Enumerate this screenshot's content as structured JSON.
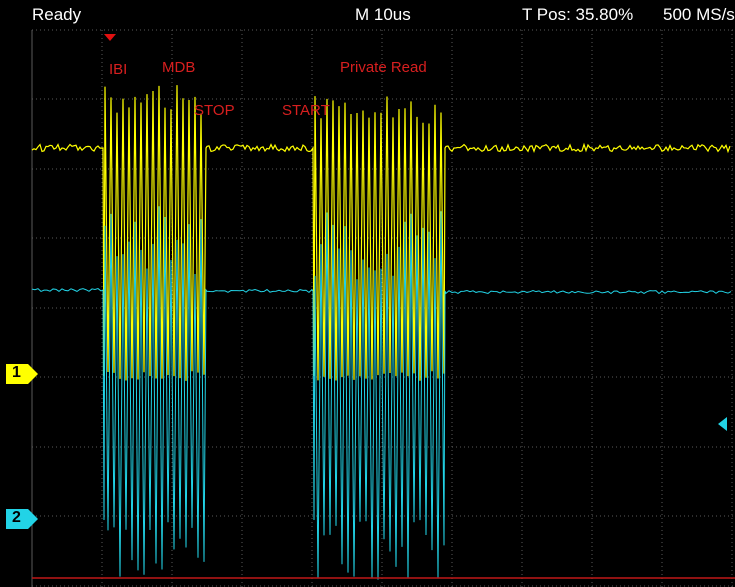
{
  "status": {
    "state": "Ready",
    "timebase": "M 10us",
    "trigger_position": "T Pos: 35.80%",
    "sample_rate": "500 MS/s"
  },
  "annotations": {
    "ibi": "IBI",
    "mdb": "MDB",
    "stop": "STOP",
    "start": "START",
    "private_read": "Private Read"
  },
  "channels": [
    {
      "label": "1",
      "color": "#ffff00"
    },
    {
      "label": "2",
      "color": "#22d3e6"
    }
  ],
  "colors": {
    "background": "#000000",
    "grid": "#5a5a5a",
    "annotation": "#d81f1f",
    "trigger_marker": "#e01010",
    "trigger_level_marker": "#22d3e6"
  }
}
